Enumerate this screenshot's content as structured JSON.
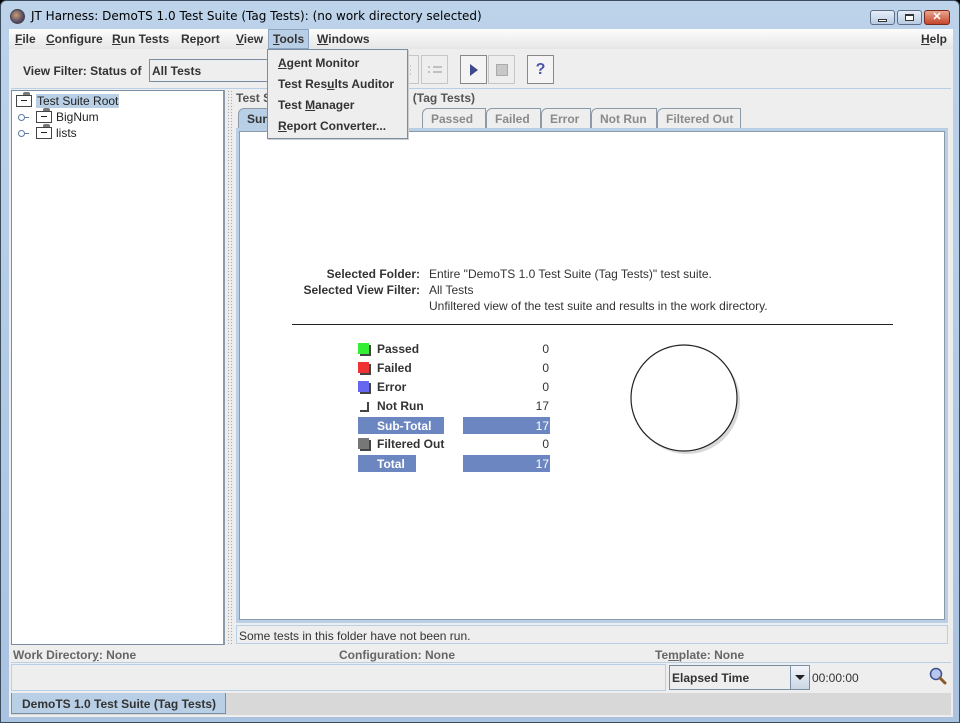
{
  "window": {
    "title": "JT Harness: DemoTS 1.0 Test Suite (Tag Tests): (no work directory selected)",
    "controls": [
      "minimize",
      "maximize",
      "close"
    ]
  },
  "menubar": {
    "items": [
      {
        "label": "File",
        "mnemonic": "F",
        "rest": "ile"
      },
      {
        "label": "Configure",
        "mnemonic": "C",
        "rest": "onfigure"
      },
      {
        "label": "Run Tests",
        "mnemonic": "R",
        "rest": "un Tests"
      },
      {
        "label": "Report",
        "pre": "Re",
        "mnemonic": "p",
        "rest": "ort"
      },
      {
        "label": "View",
        "mnemonic": "V",
        "rest": "iew"
      },
      {
        "label": "Tools",
        "mnemonic": "T",
        "rest": "ools",
        "active": true
      },
      {
        "label": "Windows",
        "mnemonic": "W",
        "rest": "indows"
      },
      {
        "label": "Help",
        "mnemonic": "H",
        "rest": "elp"
      }
    ]
  },
  "tools_menu": {
    "items": [
      {
        "label": "Agent Monitor",
        "pre": "",
        "mnemonic": "A",
        "rest": "gent Monitor"
      },
      {
        "label": "Test Results Auditor",
        "pre": "Test Res",
        "mnemonic": "u",
        "rest": "lts Auditor"
      },
      {
        "label": "Test Manager",
        "pre": "Test ",
        "mnemonic": "M",
        "rest": "anager"
      },
      {
        "label": "Report Converter...",
        "pre": "",
        "mnemonic": "R",
        "rest": "eport Converter..."
      }
    ]
  },
  "toolbar": {
    "view_filter_label": "View Filter: Status of",
    "view_filter_value": "All Tests",
    "buttons": [
      {
        "name": "tree-view-icon",
        "enabled": false
      },
      {
        "name": "list-view-icon",
        "enabled": false
      },
      {
        "name": "start-run-icon",
        "enabled": true
      },
      {
        "name": "stop-run-icon",
        "enabled": false
      },
      {
        "name": "help-icon",
        "enabled": true
      }
    ]
  },
  "tree": {
    "nodes": [
      {
        "label": "Test Suite Root",
        "selected": true,
        "level": 0
      },
      {
        "label": "BigNum",
        "selected": false,
        "level": 1
      },
      {
        "label": "lists",
        "selected": false,
        "level": 1
      }
    ]
  },
  "details": {
    "title_left": "Test S",
    "title_right": "uite (Tag Tests)",
    "tabs": [
      {
        "label": "Summary",
        "visible_text": "Sun",
        "selected": true
      },
      {
        "label": "Passed",
        "selected": false
      },
      {
        "label": "Failed",
        "selected": false
      },
      {
        "label": "Error",
        "selected": false
      },
      {
        "label": "Not Run",
        "selected": false
      },
      {
        "label": "Filtered Out",
        "selected": false
      }
    ],
    "selected_folder_label": "Selected Folder:",
    "selected_folder_value": "Entire \"DemoTS 1.0 Test Suite (Tag Tests)\" test suite.",
    "selected_filter_label": "Selected View Filter:",
    "selected_filter_value": "All Tests",
    "selected_filter_desc": "Unfiltered view of the test suite and results in the work directory.",
    "stats": [
      {
        "label": "Passed",
        "value": "0",
        "color": "#33ee33"
      },
      {
        "label": "Failed",
        "value": "0",
        "color": "#ee3333"
      },
      {
        "label": "Error",
        "value": "0",
        "color": "#6666ee"
      },
      {
        "label": "Not Run",
        "value": "17",
        "color": "#ffffff"
      },
      {
        "label": "Sub-Total",
        "value": "17",
        "total": true
      },
      {
        "label": "Filtered Out",
        "value": "0",
        "color": "#777777"
      },
      {
        "label": "Total",
        "value": "17",
        "total": true
      }
    ],
    "status_message": "Some tests in this folder have not been run."
  },
  "infobar": {
    "work_directory": {
      "pre": "Work Director",
      "mnemonic": "y",
      "rest": ": None"
    },
    "configuration": {
      "pre": "Confi",
      "mnemonic": "g",
      "rest": "uration: None"
    },
    "template": {
      "pre": "Te",
      "mnemonic": "m",
      "rest": "plate: None"
    }
  },
  "bottom": {
    "time_mode": "Elapsed Time",
    "elapsed": "00:00:00"
  },
  "doc_tab": "DemoTS 1.0 Test Suite (Tag Tests)",
  "colors": {
    "accent": "#b8cfe5",
    "total_bar": "#6b86c0"
  }
}
